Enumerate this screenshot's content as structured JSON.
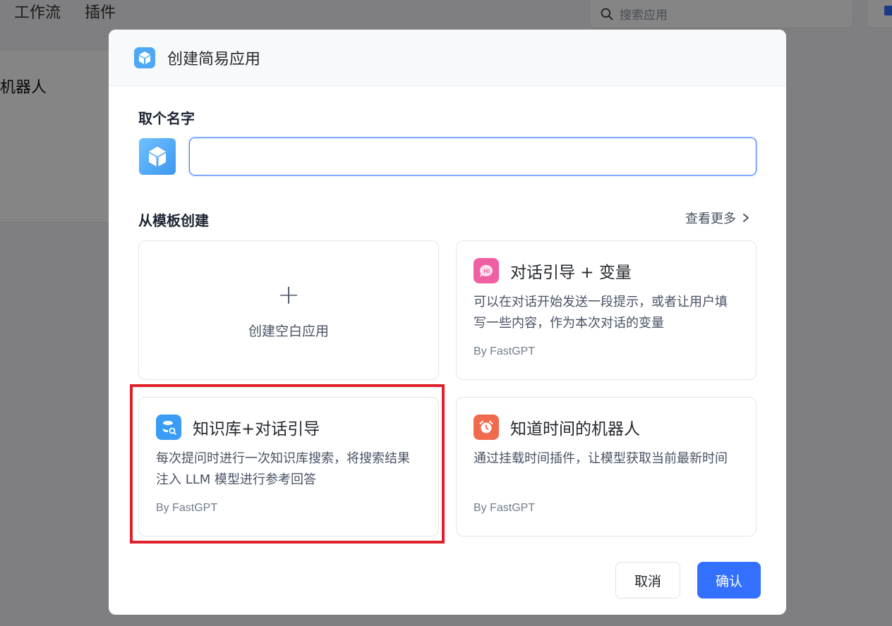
{
  "background": {
    "nav": [
      "工作流",
      "插件"
    ],
    "search_placeholder": "搜索应用",
    "card_title": "机器人"
  },
  "modal": {
    "title": "创建简易应用",
    "name_label": "取个名字",
    "name_value": "",
    "template_label": "从模板创建",
    "more_label": "查看更多",
    "blank_card_label": "创建空白应用",
    "templates": [
      {
        "name": "对话引导 + 变量",
        "desc": "可以在对话开始发送一段提示，或者让用户填写一些内容，作为本次对话的变量",
        "author": "By FastGPT",
        "icon": "hi-chat-icon",
        "color": "#f05fa3"
      },
      {
        "name": "知识库+对话引导",
        "desc": "每次提问时进行一次知识库搜索，将搜索结果注入 LLM 模型进行参考回答",
        "author": "By FastGPT",
        "icon": "database-search-icon",
        "color": "#3a9cf5"
      },
      {
        "name": "知道时间的机器人",
        "desc": "通过挂载时间插件，让模型获取当前最新时间",
        "author": "By FastGPT",
        "icon": "alarm-clock-icon",
        "color": "#f06a4d"
      }
    ],
    "cancel_label": "取消",
    "confirm_label": "确认",
    "colors": {
      "primary": "#3370ff",
      "highlight": "#e0202b"
    }
  }
}
